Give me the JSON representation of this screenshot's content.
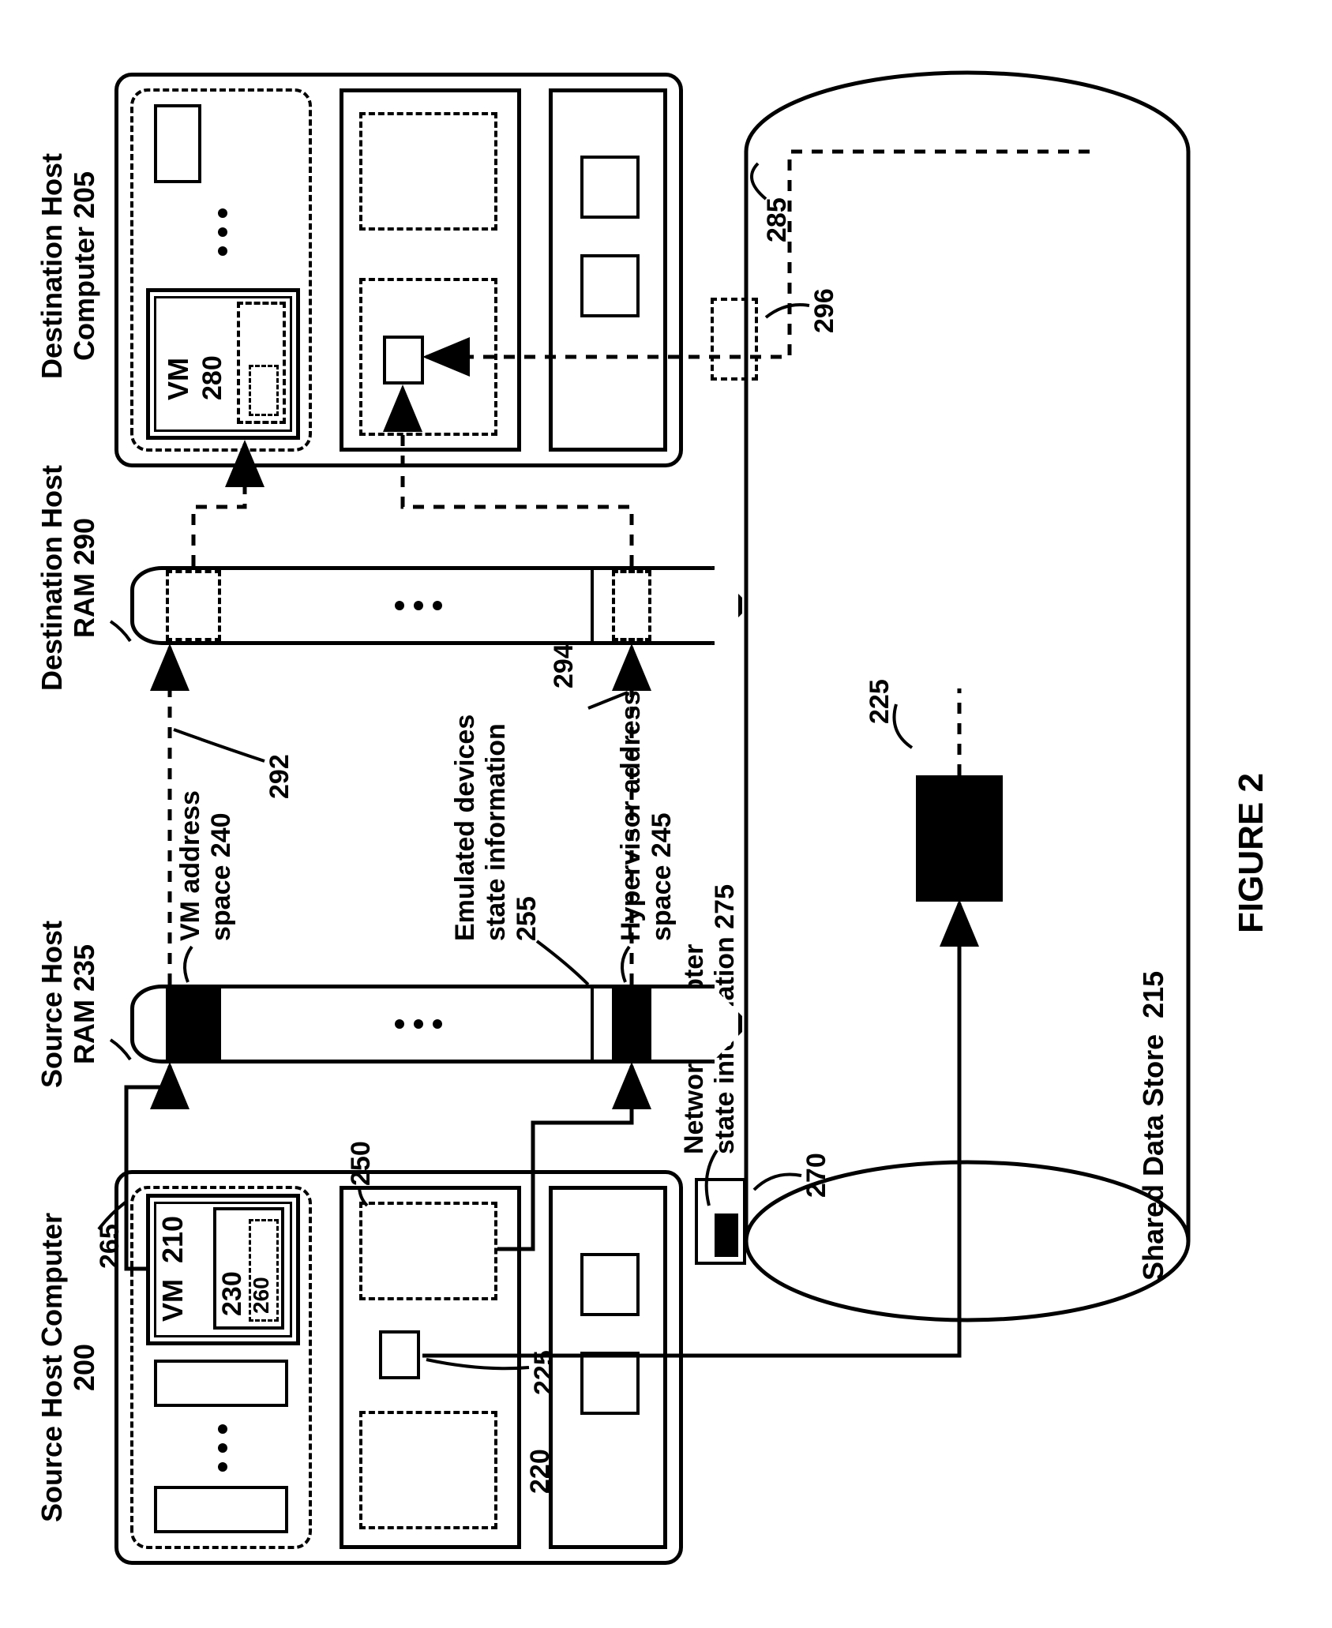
{
  "figure_label": "FIGURE 2",
  "source_host": {
    "title": "Source Host Computer",
    "num": "200",
    "vm_label": "VM",
    "vm_num": "210",
    "num_230": "230",
    "num_260": "260",
    "num_265": "265",
    "num_250": "250",
    "num_225": "225",
    "num_220": "220",
    "net_adapter_label_l1": "Network adapter",
    "net_adapter_label_l2": "state information",
    "net_adapter_num": "275",
    "num_270": "270"
  },
  "dest_host": {
    "title": "Destination Host",
    "title2": "Computer",
    "num": "205",
    "vm_label": "VM",
    "vm_num": "280",
    "num_296": "296",
    "num_285": "285"
  },
  "source_ram": {
    "title": "Source Host",
    "title2": "RAM",
    "num": "235",
    "vm_addr_l1": "VM address",
    "vm_addr_l2": "space",
    "vm_addr_num": "240",
    "emu_l1": "Emulated devices",
    "emu_l2": "state information",
    "emu_num": "255",
    "hyp_l1": "Hypervisor address",
    "hyp_l2": "space",
    "hyp_num": "245"
  },
  "dest_ram": {
    "title": "Destination Host",
    "title2": "RAM",
    "num": "290",
    "num_292": "292",
    "num_294": "294"
  },
  "datastore": {
    "title": "Shared Data Store",
    "num": "215",
    "num_225b": "225"
  }
}
